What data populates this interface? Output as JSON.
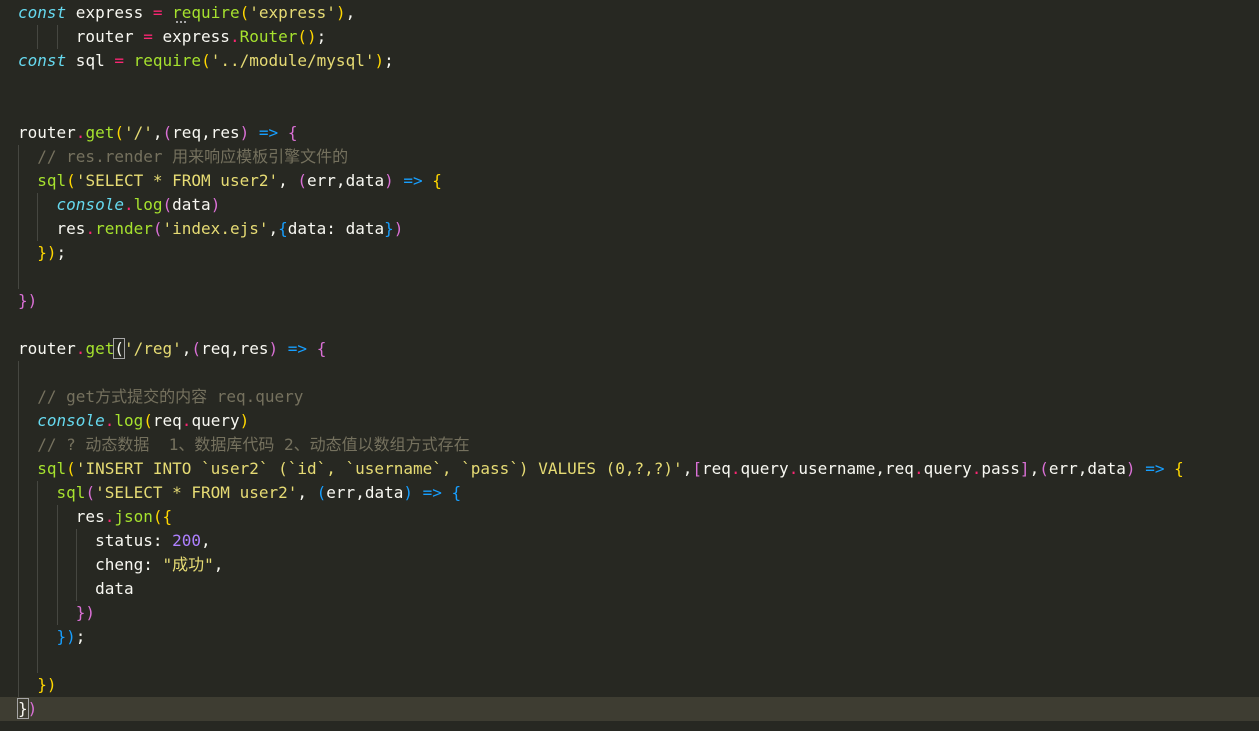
{
  "editor": {
    "lines": [
      {
        "tokens": [
          {
            "t": "const",
            "c": "k"
          },
          {
            "t": " express ",
            "c": "w"
          },
          {
            "t": "=",
            "c": "o"
          },
          {
            "t": " ",
            "c": "w"
          },
          {
            "t": "require",
            "c": "f"
          },
          {
            "t": "(",
            "c": "b1"
          },
          {
            "t": "'express'",
            "c": "s"
          },
          {
            "t": ")",
            "c": "b1"
          },
          {
            "t": ",",
            "c": "w"
          }
        ]
      },
      {
        "tokens": [
          {
            "t": "      router ",
            "c": "w"
          },
          {
            "t": "=",
            "c": "o"
          },
          {
            "t": " express",
            "c": "w"
          },
          {
            "t": ".",
            "c": "p"
          },
          {
            "t": "Router",
            "c": "f"
          },
          {
            "t": "()",
            "c": "b1"
          },
          {
            "t": ";",
            "c": "w"
          }
        ]
      },
      {
        "tokens": [
          {
            "t": "const",
            "c": "k"
          },
          {
            "t": " sql ",
            "c": "w"
          },
          {
            "t": "=",
            "c": "o"
          },
          {
            "t": " ",
            "c": "w"
          },
          {
            "t": "require",
            "c": "f"
          },
          {
            "t": "(",
            "c": "b1"
          },
          {
            "t": "'../module/mysql'",
            "c": "s"
          },
          {
            "t": ")",
            "c": "b1"
          },
          {
            "t": ";",
            "c": "w"
          }
        ]
      },
      {
        "tokens": []
      },
      {
        "tokens": []
      },
      {
        "tokens": [
          {
            "t": "router",
            "c": "w"
          },
          {
            "t": ".",
            "c": "p"
          },
          {
            "t": "get",
            "c": "f"
          },
          {
            "t": "(",
            "c": "b1"
          },
          {
            "t": "'/'",
            "c": "s"
          },
          {
            "t": ",",
            "c": "w"
          },
          {
            "t": "(",
            "c": "b2"
          },
          {
            "t": "req",
            "c": "w"
          },
          {
            "t": ",",
            "c": "w"
          },
          {
            "t": "res",
            "c": "w"
          },
          {
            "t": ")",
            "c": "b2"
          },
          {
            "t": " ",
            "c": "w"
          },
          {
            "t": "=>",
            "c": "b3"
          },
          {
            "t": " ",
            "c": "w"
          },
          {
            "t": "{",
            "c": "b2"
          }
        ]
      },
      {
        "tokens": [
          {
            "t": "  ",
            "c": "w"
          },
          {
            "t": "// res.render 用来响应模板引擎文件的",
            "c": "c"
          }
        ]
      },
      {
        "tokens": [
          {
            "t": "  ",
            "c": "w"
          },
          {
            "t": "sql",
            "c": "f"
          },
          {
            "t": "(",
            "c": "b1"
          },
          {
            "t": "'SELECT * FROM user2'",
            "c": "s"
          },
          {
            "t": ", ",
            "c": "w"
          },
          {
            "t": "(",
            "c": "b2"
          },
          {
            "t": "err",
            "c": "w"
          },
          {
            "t": ",",
            "c": "w"
          },
          {
            "t": "data",
            "c": "w"
          },
          {
            "t": ")",
            "c": "b2"
          },
          {
            "t": " ",
            "c": "w"
          },
          {
            "t": "=>",
            "c": "b3"
          },
          {
            "t": " ",
            "c": "w"
          },
          {
            "t": "{",
            "c": "b1"
          }
        ]
      },
      {
        "tokens": [
          {
            "t": "    ",
            "c": "w"
          },
          {
            "t": "console",
            "c": "it"
          },
          {
            "t": ".",
            "c": "p"
          },
          {
            "t": "log",
            "c": "f"
          },
          {
            "t": "(",
            "c": "b2"
          },
          {
            "t": "data",
            "c": "w"
          },
          {
            "t": ")",
            "c": "b2"
          }
        ]
      },
      {
        "tokens": [
          {
            "t": "    res",
            "c": "w"
          },
          {
            "t": ".",
            "c": "p"
          },
          {
            "t": "render",
            "c": "f"
          },
          {
            "t": "(",
            "c": "b2"
          },
          {
            "t": "'index.ejs'",
            "c": "s"
          },
          {
            "t": ",",
            "c": "w"
          },
          {
            "t": "{",
            "c": "b3"
          },
          {
            "t": "data: data",
            "c": "w"
          },
          {
            "t": "}",
            "c": "b3"
          },
          {
            "t": ")",
            "c": "b2"
          }
        ]
      },
      {
        "tokens": [
          {
            "t": "  ",
            "c": "w"
          },
          {
            "t": "}",
            "c": "b1"
          },
          {
            "t": ")",
            "c": "b1"
          },
          {
            "t": ";",
            "c": "w"
          }
        ]
      },
      {
        "tokens": []
      },
      {
        "tokens": [
          {
            "t": "})",
            "c": "b2"
          }
        ]
      },
      {
        "tokens": []
      },
      {
        "tokens": [
          {
            "t": "router",
            "c": "w"
          },
          {
            "t": ".",
            "c": "p"
          },
          {
            "t": "get",
            "c": "f"
          },
          {
            "t": "(",
            "c": "bm"
          },
          {
            "t": "'/reg'",
            "c": "s"
          },
          {
            "t": ",",
            "c": "w"
          },
          {
            "t": "(",
            "c": "b2"
          },
          {
            "t": "req",
            "c": "w"
          },
          {
            "t": ",",
            "c": "w"
          },
          {
            "t": "res",
            "c": "w"
          },
          {
            "t": ")",
            "c": "b2"
          },
          {
            "t": " ",
            "c": "w"
          },
          {
            "t": "=>",
            "c": "b3"
          },
          {
            "t": " ",
            "c": "w"
          },
          {
            "t": "{",
            "c": "b2"
          }
        ]
      },
      {
        "tokens": []
      },
      {
        "tokens": [
          {
            "t": "  ",
            "c": "w"
          },
          {
            "t": "// get方式提交的内容 req.query",
            "c": "c"
          }
        ]
      },
      {
        "tokens": [
          {
            "t": "  ",
            "c": "w"
          },
          {
            "t": "console",
            "c": "it"
          },
          {
            "t": ".",
            "c": "p"
          },
          {
            "t": "log",
            "c": "f"
          },
          {
            "t": "(",
            "c": "b1"
          },
          {
            "t": "req",
            "c": "w"
          },
          {
            "t": ".",
            "c": "p"
          },
          {
            "t": "query",
            "c": "w"
          },
          {
            "t": ")",
            "c": "b1"
          }
        ]
      },
      {
        "tokens": [
          {
            "t": "  ",
            "c": "w"
          },
          {
            "t": "// ? 动态数据  1、数据库代码 2、动态值以数组方式存在",
            "c": "c"
          }
        ]
      },
      {
        "tokens": [
          {
            "t": "  ",
            "c": "w"
          },
          {
            "t": "sql",
            "c": "f"
          },
          {
            "t": "(",
            "c": "b1"
          },
          {
            "t": "'INSERT INTO `user2` (`id`, `username`, `pass`) VALUES (0,?,?)'",
            "c": "s"
          },
          {
            "t": ",",
            "c": "w"
          },
          {
            "t": "[",
            "c": "b2"
          },
          {
            "t": "req",
            "c": "w"
          },
          {
            "t": ".",
            "c": "p"
          },
          {
            "t": "query",
            "c": "w"
          },
          {
            "t": ".",
            "c": "p"
          },
          {
            "t": "username",
            "c": "w"
          },
          {
            "t": ",",
            "c": "w"
          },
          {
            "t": "req",
            "c": "w"
          },
          {
            "t": ".",
            "c": "p"
          },
          {
            "t": "query",
            "c": "w"
          },
          {
            "t": ".",
            "c": "p"
          },
          {
            "t": "pass",
            "c": "w"
          },
          {
            "t": "]",
            "c": "b2"
          },
          {
            "t": ",",
            "c": "w"
          },
          {
            "t": "(",
            "c": "b2"
          },
          {
            "t": "err",
            "c": "w"
          },
          {
            "t": ",",
            "c": "w"
          },
          {
            "t": "data",
            "c": "w"
          },
          {
            "t": ")",
            "c": "b2"
          },
          {
            "t": " ",
            "c": "w"
          },
          {
            "t": "=>",
            "c": "b3"
          },
          {
            "t": " ",
            "c": "w"
          },
          {
            "t": "{",
            "c": "b1"
          }
        ]
      },
      {
        "tokens": [
          {
            "t": "    ",
            "c": "w"
          },
          {
            "t": "sql",
            "c": "f"
          },
          {
            "t": "(",
            "c": "b2"
          },
          {
            "t": "'SELECT * FROM user2'",
            "c": "s"
          },
          {
            "t": ", ",
            "c": "w"
          },
          {
            "t": "(",
            "c": "b3"
          },
          {
            "t": "err",
            "c": "w"
          },
          {
            "t": ",",
            "c": "w"
          },
          {
            "t": "data",
            "c": "w"
          },
          {
            "t": ")",
            "c": "b3"
          },
          {
            "t": " ",
            "c": "w"
          },
          {
            "t": "=>",
            "c": "b3"
          },
          {
            "t": " ",
            "c": "w"
          },
          {
            "t": "{",
            "c": "b3"
          }
        ]
      },
      {
        "tokens": [
          {
            "t": "      res",
            "c": "w"
          },
          {
            "t": ".",
            "c": "p"
          },
          {
            "t": "json",
            "c": "f"
          },
          {
            "t": "(",
            "c": "b1"
          },
          {
            "t": "{",
            "c": "b1"
          }
        ]
      },
      {
        "tokens": [
          {
            "t": "        status: ",
            "c": "w"
          },
          {
            "t": "200",
            "c": "n"
          },
          {
            "t": ",",
            "c": "w"
          }
        ]
      },
      {
        "tokens": [
          {
            "t": "        cheng: ",
            "c": "w"
          },
          {
            "t": "\"成功\"",
            "c": "s"
          },
          {
            "t": ",",
            "c": "w"
          }
        ]
      },
      {
        "tokens": [
          {
            "t": "        data",
            "c": "w"
          }
        ]
      },
      {
        "tokens": [
          {
            "t": "      ",
            "c": "w"
          },
          {
            "t": "})",
            "c": "b2"
          }
        ]
      },
      {
        "tokens": [
          {
            "t": "    ",
            "c": "w"
          },
          {
            "t": "})",
            "c": "b3"
          },
          {
            "t": ";",
            "c": "w"
          }
        ]
      },
      {
        "tokens": []
      },
      {
        "tokens": [
          {
            "t": "  ",
            "c": "w"
          },
          {
            "t": "})",
            "c": "b1"
          }
        ]
      },
      {
        "tokens": [
          {
            "t": "}",
            "c": "bm"
          },
          {
            "t": ")",
            "c": "b2"
          }
        ]
      }
    ],
    "active_line": 29,
    "guides": [
      {
        "line": 1,
        "cols": [
          2,
          4
        ]
      },
      {
        "line": 6,
        "cols": [
          0
        ]
      },
      {
        "line": 7,
        "cols": [
          0
        ]
      },
      {
        "line": 8,
        "cols": [
          0,
          2
        ]
      },
      {
        "line": 9,
        "cols": [
          0,
          2
        ]
      },
      {
        "line": 10,
        "cols": [
          0
        ]
      },
      {
        "line": 11,
        "cols": [
          0
        ]
      },
      {
        "line": 15,
        "cols": [
          0
        ]
      },
      {
        "line": 16,
        "cols": [
          0
        ]
      },
      {
        "line": 17,
        "cols": [
          0
        ]
      },
      {
        "line": 18,
        "cols": [
          0
        ]
      },
      {
        "line": 19,
        "cols": [
          0
        ]
      },
      {
        "line": 20,
        "cols": [
          0,
          2
        ]
      },
      {
        "line": 21,
        "cols": [
          0,
          2,
          4
        ]
      },
      {
        "line": 22,
        "cols": [
          0,
          2,
          4,
          6
        ]
      },
      {
        "line": 23,
        "cols": [
          0,
          2,
          4,
          6
        ]
      },
      {
        "line": 24,
        "cols": [
          0,
          2,
          4,
          6
        ]
      },
      {
        "line": 25,
        "cols": [
          0,
          2,
          4
        ]
      },
      {
        "line": 26,
        "cols": [
          0,
          2
        ]
      },
      {
        "line": 27,
        "cols": [
          0,
          2
        ]
      },
      {
        "line": 28,
        "cols": [
          0
        ]
      }
    ],
    "colors": {
      "background": "#272822",
      "active_line": "#3e3d32",
      "keyword": "#66d9ef",
      "function": "#a6e22e",
      "string": "#e6db74",
      "operator": "#f92672",
      "comment": "#75715e",
      "number": "#ae81ff"
    }
  }
}
